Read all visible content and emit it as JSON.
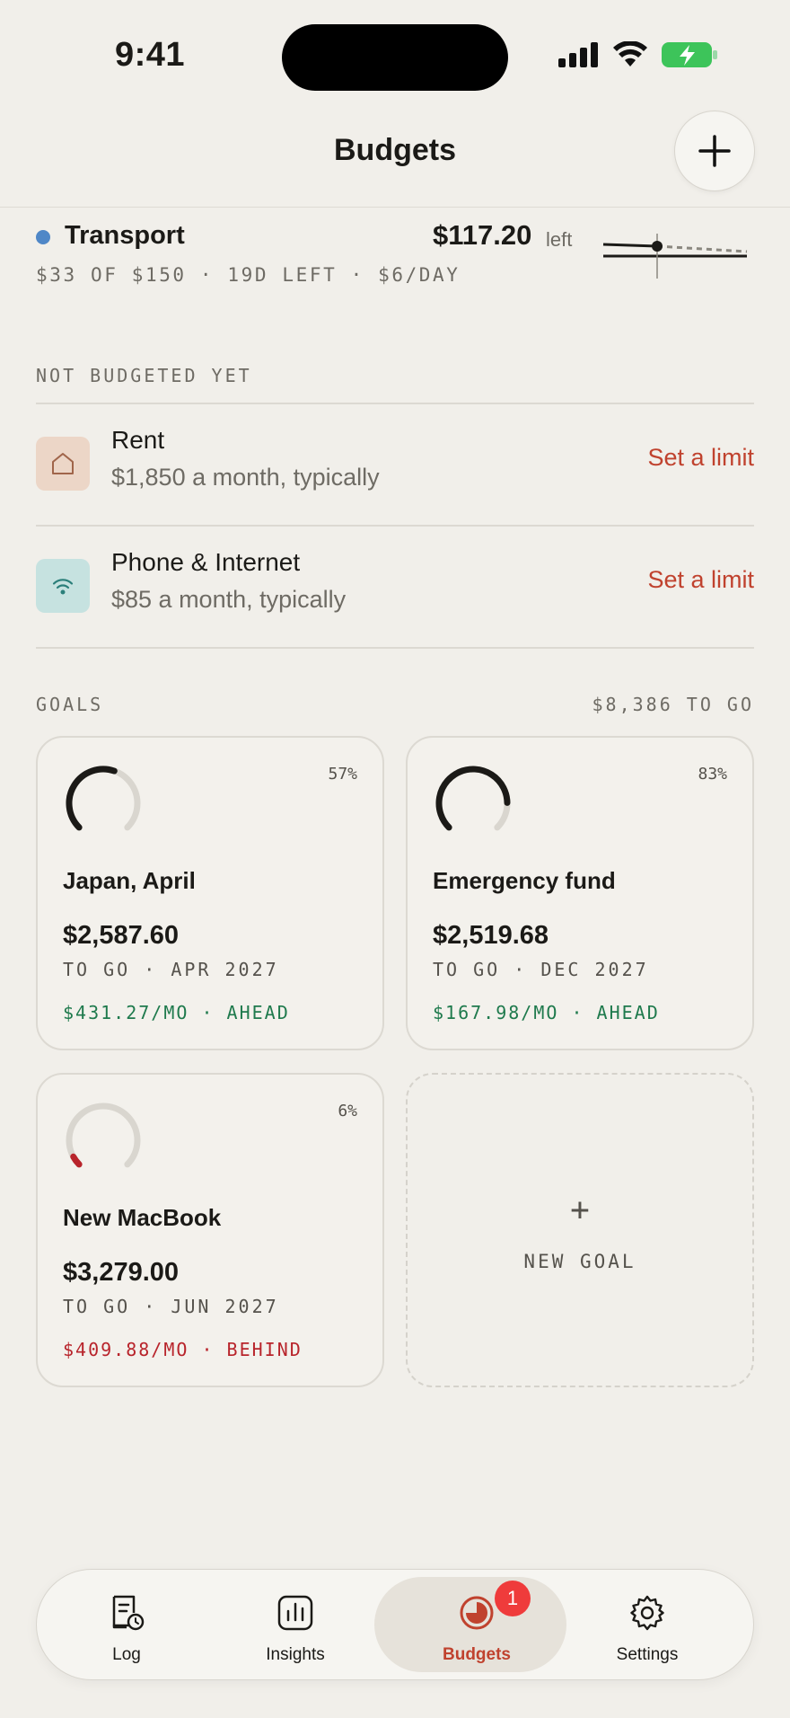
{
  "status_bar": {
    "time": "9:41"
  },
  "header": {
    "title": "Budgets",
    "add_icon": "plus-icon"
  },
  "transport": {
    "name": "Transport",
    "amount": "$117.20",
    "left_label": "left",
    "subtitle": "$33 OF $150 · 19D LEFT · $6/DAY",
    "dot_color": "#4f87c7"
  },
  "not_budgeted": {
    "label": "NOT BUDGETED YET",
    "items": [
      {
        "title": "Rent",
        "subtitle": "$1,850 a month, typically",
        "action": "Set a limit",
        "icon": "home-icon"
      },
      {
        "title": "Phone & Internet",
        "subtitle": "$85 a month, typically",
        "action": "Set a limit",
        "icon": "wifi-icon"
      }
    ]
  },
  "goals": {
    "label": "GOALS",
    "total": "$8,386 TO GO",
    "items": [
      {
        "name": "Japan, April",
        "pct": "57%",
        "progress": 0.57,
        "amount": "$2,587.60",
        "meta": "TO GO · APR 2027",
        "rate": "$431.27/MO · AHEAD",
        "status": "ahead"
      },
      {
        "name": "Emergency fund",
        "pct": "83%",
        "progress": 0.83,
        "amount": "$2,519.68",
        "meta": "TO GO · DEC 2027",
        "rate": "$167.98/MO · AHEAD",
        "status": "ahead"
      },
      {
        "name": "New MacBook",
        "pct": "6%",
        "progress": 0.06,
        "amount": "$3,279.00",
        "meta": "TO GO · JUN 2027",
        "rate": "$409.88/MO · BEHIND",
        "status": "behind"
      }
    ],
    "new_goal_plus": "+",
    "new_goal_label": "NEW GOAL"
  },
  "tabbar": {
    "tabs": [
      {
        "label": "Log",
        "icon": "receipt-clock-icon"
      },
      {
        "label": "Insights",
        "icon": "bar-chart-icon"
      },
      {
        "label": "Budgets",
        "icon": "pie-chart-icon",
        "badge": "1",
        "active": true
      },
      {
        "label": "Settings",
        "icon": "gear-icon"
      }
    ]
  },
  "colors": {
    "accent": "#c0422e",
    "ahead": "#1f7a4d",
    "behind": "#b8242b",
    "background": "#f1efea"
  }
}
